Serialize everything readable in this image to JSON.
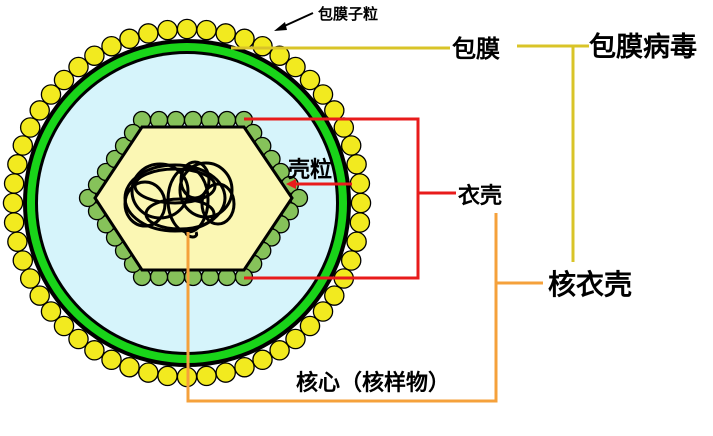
{
  "labels": {
    "envelope_subunit": "包膜子粒",
    "envelope": "包膜",
    "enveloped_virus": "包膜病毒",
    "capsomere": "壳粒",
    "capsid": "衣壳",
    "nucleocapsid": "核衣壳",
    "core": "核心（核样物）"
  },
  "colors": {
    "subunit_yellow": "#f2ea1f",
    "envelope_green": "#19d419",
    "matrix_blue": "#d6f4fb",
    "capsomere_green": "#86c25a",
    "capsid_fill": "#fbf7b4",
    "line_red": "#e81b1b",
    "line_gold": "#d9c428",
    "line_orange": "#f5a13b"
  },
  "icons": {
    "envelope_subunit": "yellow-circle",
    "capsomere": "green-circle",
    "nucleic_acid": "tangled-coil"
  }
}
